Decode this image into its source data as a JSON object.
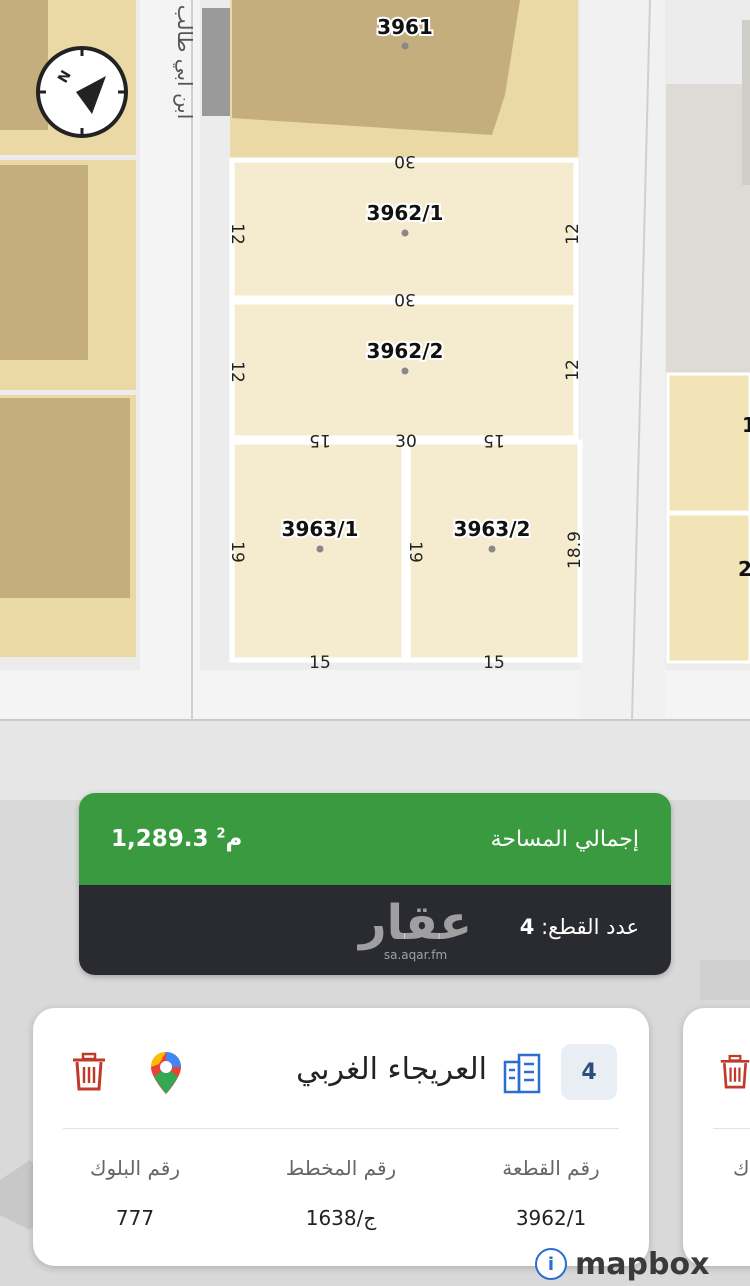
{
  "map": {
    "street_label": "ابن ابي طالب",
    "parcels": [
      {
        "id": "3961"
      },
      {
        "id": "3962/1"
      },
      {
        "id": "3962/2"
      },
      {
        "id": "3963/1"
      },
      {
        "id": "3963/2"
      }
    ],
    "dimensions": {
      "top": "30",
      "p1_left": "12",
      "p1_right": "12",
      "mid": "30",
      "p2_left": "12",
      "p2_right": "12",
      "split": "30",
      "split_l": "15",
      "split_r": "15",
      "p3_left": "19",
      "p3_mid": "19",
      "p3_right": "18.9",
      "bottom_l": "15",
      "bottom_r": "15"
    },
    "right_partial_1": "1",
    "right_partial_2": "2"
  },
  "summary": {
    "area_label": "إجمالي المساحة",
    "area_value": "1,289.3 م",
    "area_unit_sup": "2",
    "count_label": "عدد القطع: ",
    "count_value": "4",
    "watermark_big": "عقار",
    "watermark_small": "sa.aqar.fm"
  },
  "card": {
    "badge": "4",
    "district": "العريجاء الغربي",
    "parcel_label": "رقم القطعة",
    "parcel_value": "3962/1",
    "plan_label": "رقم المخطط",
    "plan_value": "1638/ج",
    "block_label": "رقم البلوك",
    "block_value": "777",
    "icons": [
      "building-icon",
      "google-maps-pin-icon",
      "trash-icon"
    ]
  },
  "card2": {
    "partial_text": "ك"
  },
  "footer": {
    "brand": "mapbox",
    "info_glyph": "i"
  },
  "colors": {
    "parcel_light": "#f5ecd0",
    "parcel_gold": "#d8c59a",
    "building": "#bea675",
    "green": "#3a9a40",
    "dark": "#2a2b30",
    "trash": "#c0392b",
    "building_icon": "#2a6fd0"
  }
}
